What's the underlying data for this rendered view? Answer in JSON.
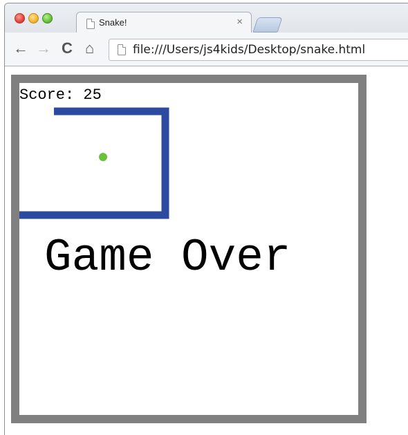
{
  "browser": {
    "tab": {
      "title": "Snake!",
      "close_glyph": "×",
      "icon": "page-icon"
    },
    "toolbar": {
      "back_glyph": "←",
      "forward_glyph": "→",
      "reload_glyph": "C",
      "home_glyph": "⌂",
      "url": "file:///Users/js4kids/Desktop/snake.html"
    }
  },
  "game": {
    "score_text": "Score: 25",
    "game_over_text": "Game Over",
    "colors": {
      "border": "#808080",
      "snake": "#2b4aa0",
      "apple": "#6ac23a"
    }
  }
}
